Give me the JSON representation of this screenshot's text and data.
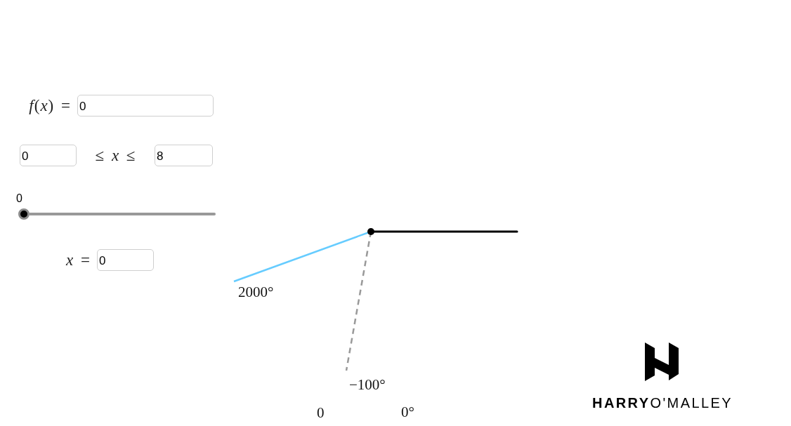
{
  "function_row": {
    "label": "*f*(*x*) =",
    "value": "0"
  },
  "domain_row": {
    "min_value": "0",
    "label": "≤ *x* ≤",
    "max_value": "8"
  },
  "slider": {
    "reading": "0",
    "level": 0
  },
  "x_row": {
    "label": "*x* =",
    "value": "0"
  },
  "diagram": {
    "labels": [
      "2000°",
      "−100°",
      "0",
      "0°"
    ]
  },
  "logo": {
    "text": "**HARRY**O'MALLEY"
  }
}
